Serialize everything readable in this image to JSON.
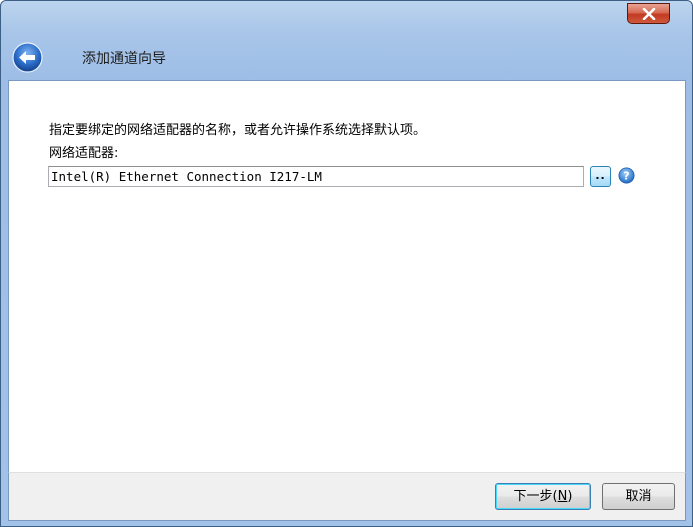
{
  "window": {
    "title": "添加通道向导"
  },
  "content": {
    "instruction": "指定要绑定的网络适配器的名称，或者允许操作系统选择默认项。",
    "adapter_label": "网络适配器:",
    "adapter_value": "Intel(R) Ethernet Connection I217-LM",
    "browse_label": ".."
  },
  "footer": {
    "next_prefix": "下一步(",
    "next_mnemonic": "N",
    "next_suffix": ")",
    "cancel_label": "取消"
  },
  "icons": {
    "back": "back-arrow-icon",
    "close": "close-icon",
    "help": "help-icon"
  },
  "colors": {
    "title_bar": "#a9c6e9",
    "close_button": "#c13a22",
    "back_button": "#2a6cc9",
    "help_icon": "#2f7fd6"
  }
}
